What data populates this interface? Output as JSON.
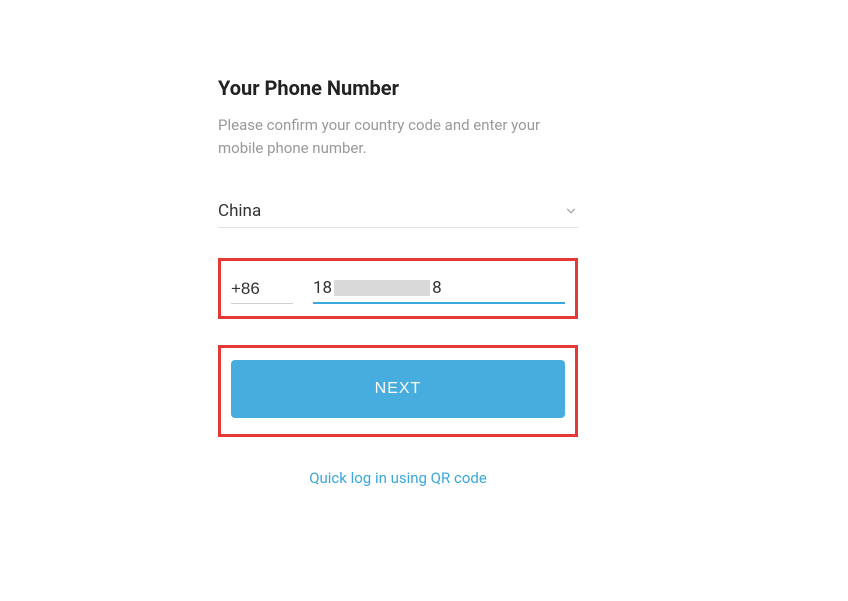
{
  "title": "Your Phone Number",
  "subtitle": "Please confirm your country code and enter your mobile phone number.",
  "country": {
    "selected": "China"
  },
  "phone": {
    "code": "+86",
    "number_prefix": "18",
    "number_suffix": "8"
  },
  "next_button": "NEXT",
  "qr_link": "Quick log in using QR code",
  "colors": {
    "accent": "#3ba7dd",
    "button": "#47acde",
    "highlight": "#e53935"
  }
}
